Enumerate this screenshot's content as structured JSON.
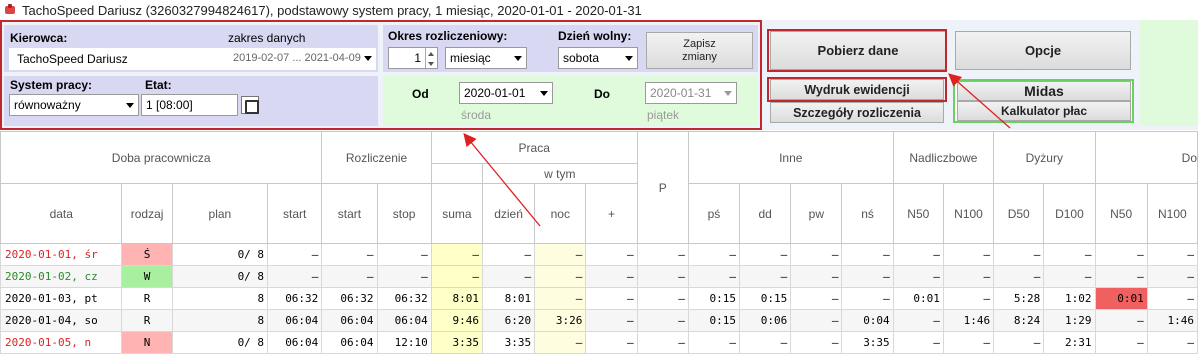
{
  "window": {
    "title": "TachoSpeed Dariusz (3260327994824617), podstawowy system pracy, 1 miesiąc, 2020-01-01 - 2020-01-31"
  },
  "driver": {
    "label": "Kierowca:",
    "range_label": "zakres danych",
    "name": "TachoSpeed Dariusz",
    "range": "2019-02-07 ... 2021-04-09"
  },
  "period": {
    "label": "Okres rozliczeniowy:",
    "count": "1",
    "unit": "miesiąc",
    "free_day_label": "Dzień wolny:",
    "free_day": "sobota",
    "save_button": "Zapisz\nzmiany"
  },
  "system": {
    "label": "System pracy:",
    "value": "równoważny",
    "etat_label": "Etat:",
    "etat_value": "1  [08:00]"
  },
  "dates": {
    "from_label": "Od",
    "from_value": "2020-01-01",
    "from_day": "środa",
    "to_label": "Do",
    "to_value": "2020-01-31",
    "to_day": "piątek"
  },
  "buttons": {
    "fetch": "Pobierz dane",
    "options": "Opcje",
    "print": "Wydruk ewidencji",
    "details": "Szczegóły rozliczenia",
    "midas": "Midas",
    "calculator": "Kalkulator płac"
  },
  "table": {
    "group_headers": {
      "doba": "Doba pracownicza",
      "rozliczenie": "Rozliczenie",
      "praca": "Praca",
      "w_tym": "w tym",
      "p": "P",
      "inne": "Inne",
      "nadliczbowe": "Nadliczbowe",
      "dyzury": "Dyżury",
      "do": "Do"
    },
    "columns": [
      "data",
      "rodzaj",
      "plan",
      "start",
      "start",
      "stop",
      "suma",
      "dzień",
      "noc",
      "+",
      "pś",
      "dd",
      "pw",
      "nś",
      "N50",
      "N100",
      "D50",
      "D100",
      "N50",
      "N100"
    ],
    "rows": [
      [
        "2020-01-01, śr",
        "Ś",
        "0/ 8",
        "–",
        "–",
        "–",
        "–",
        "–",
        "–",
        "–",
        "–",
        "–",
        "–",
        "–",
        "–",
        "–",
        "–",
        "–",
        "–",
        "–",
        "–"
      ],
      [
        "2020-01-02, cz",
        "W",
        "0/ 8",
        "–",
        "–",
        "–",
        "–",
        "–",
        "–",
        "–",
        "–",
        "–",
        "–",
        "–",
        "–",
        "–",
        "–",
        "–",
        "–",
        "–",
        "–"
      ],
      [
        "2020-01-03, pt",
        "R",
        "8",
        "06:32",
        "06:32",
        "06:32",
        "8:01",
        "8:01",
        "–",
        "–",
        "–",
        "0:15",
        "0:15",
        "–",
        "–",
        "0:01",
        "–",
        "5:28",
        "1:02",
        "0:01",
        "–"
      ],
      [
        "2020-01-04, so",
        "R",
        "8",
        "06:04",
        "06:04",
        "06:04",
        "9:46",
        "6:20",
        "3:26",
        "–",
        "–",
        "0:15",
        "0:06",
        "–",
        "0:04",
        "–",
        "1:46",
        "8:24",
        "1:29",
        "–",
        "1:46"
      ],
      [
        "2020-01-05, n",
        "N",
        "0/ 8",
        "06:04",
        "06:04",
        "12:10",
        "3:35",
        "3:35",
        "–",
        "–",
        "–",
        "–",
        "–",
        "–",
        "3:35",
        "–",
        "–",
        "–",
        "2:31",
        "–",
        "–"
      ]
    ]
  }
}
